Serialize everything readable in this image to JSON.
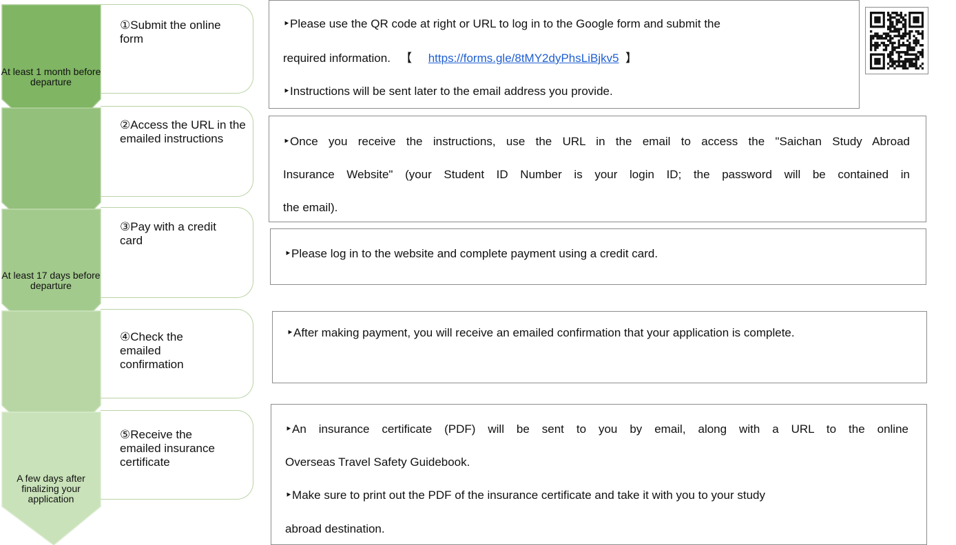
{
  "colors": {
    "stage1": "#7fb563",
    "stage2": "#a3ca8d",
    "stage3": "#c9e2b9",
    "step_border": "#b9d3a4",
    "box_border": "#8c8c8c",
    "link": "#1f5fd1"
  },
  "stages": [
    {
      "timing": "At least 1 month before departure"
    },
    {
      "timing": "At least 17 days before departure"
    },
    {
      "timing": "A few days after finalizing your application"
    }
  ],
  "steps": [
    {
      "title": "①Submit the online form"
    },
    {
      "title": "②Access the URL in the emailed instructions"
    },
    {
      "title": "③Pay with a credit card"
    },
    {
      "title": "④Check the emailed confirmation"
    },
    {
      "title": "⑤Receive the emailed insurance certificate"
    }
  ],
  "boxes": {
    "box1": {
      "line1": "‣Please use the QR code at right or URL to log in to the Google form and submit the",
      "line2_pre": "required information.",
      "bracket_open": "【",
      "url": "https://forms.gle/8tMY2dyPhsLiBjkv5",
      "bracket_close": "】",
      "line3": "‣Instructions will be sent later to the email address you provide."
    },
    "box2": {
      "line1": "‣Once you receive the instructions, use the URL in the email to access the \"Saichan Study Abroad",
      "line2": "Insurance Website\" (your Student ID Number is your login ID; the password will be contained in",
      "line3": "the email)."
    },
    "box3": {
      "line1": "‣Please log in to the website and complete payment using a credit card."
    },
    "box4": {
      "line1": "‣After making payment, you will receive an emailed confirmation that your application is complete."
    },
    "box5": {
      "line1": "‣An insurance certificate (PDF) will be sent to you by email, along with a URL to the online",
      "line2": "Overseas Travel Safety Guidebook.",
      "line3": "‣Make sure to print out the PDF of the insurance certificate and take it with you to your study",
      "line4": "abroad destination."
    }
  },
  "qr": {
    "icon": "qr-code-icon"
  }
}
